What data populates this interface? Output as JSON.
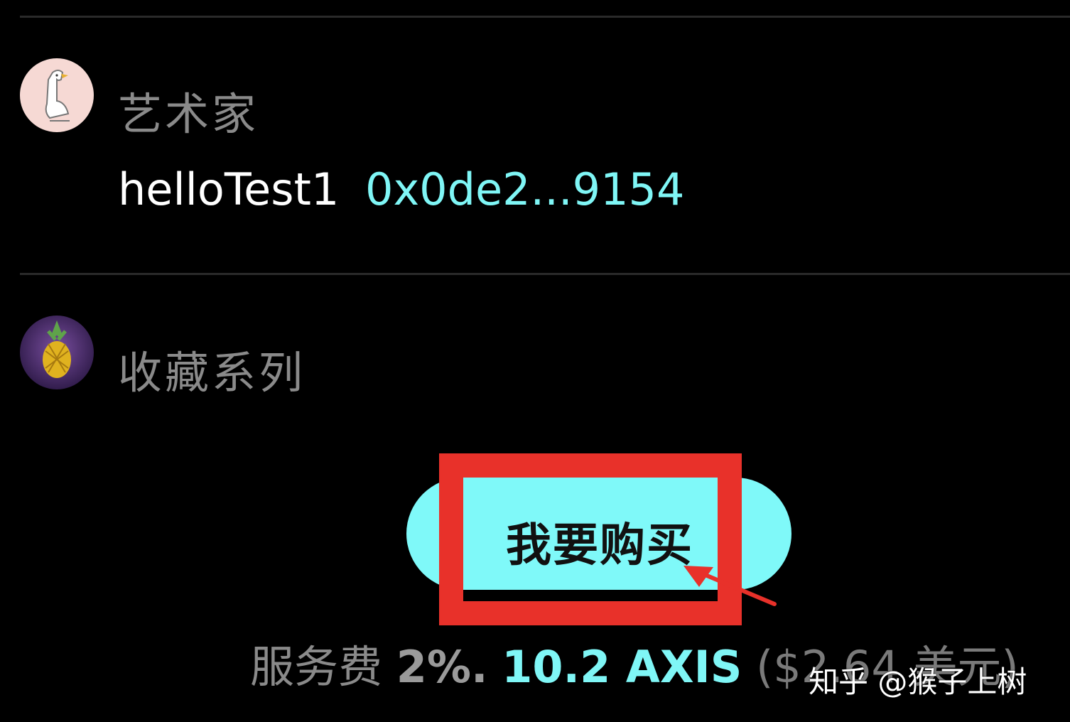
{
  "artist": {
    "label": "艺术家",
    "name": "helloTest1",
    "address": "0x0de2...9154"
  },
  "collection": {
    "label": "收藏系列"
  },
  "buy_button": {
    "label": "我要购买"
  },
  "fee": {
    "label": "服务费",
    "percent": "2%.",
    "amount": "10.2 AXIS",
    "usd": "($2.64 美元)"
  },
  "watermark": "知乎 @猴子上树",
  "colors": {
    "accent": "#7ff9f9",
    "highlight": "#e8312a",
    "background": "#000000"
  }
}
